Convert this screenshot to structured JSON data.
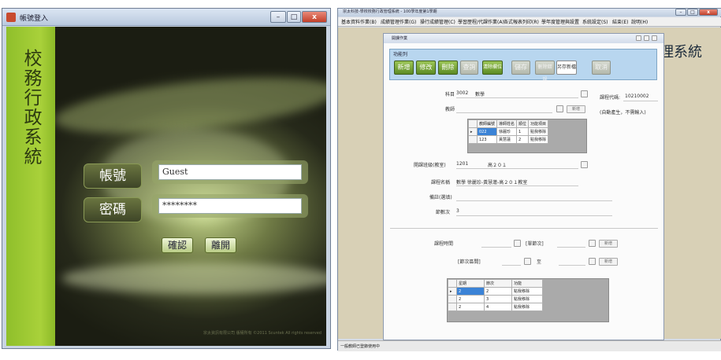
{
  "login": {
    "title": "帳號登入",
    "window_controls": [
      "–",
      "□",
      "x"
    ],
    "vertical_title": "校務行政系統",
    "account_label": "帳號",
    "account_value": "Guest",
    "password_label": "密碼",
    "password_value": "********",
    "confirm_button": "確認",
    "leave_button": "離開",
    "copyright": "宗太資訊有限公司 版權所有 ©2011 Scuntek All rights reserved"
  },
  "main": {
    "title": "宗太科技-學校校務行政管理系統 - 100學年度第1學期",
    "menu": [
      "基本資料作業(B)",
      "成績管理作業(G)",
      "操行成績管理(C)",
      "學習歷程/代課作業(A)",
      "各式報表列印(R)",
      "學年度管理與設置",
      "系統設定(S)",
      "結束(E)",
      "說明(H)"
    ],
    "banner": "理系統",
    "status": "一般教師已登錄使用中",
    "form": {
      "title": "開課作業",
      "group_label": "功能列",
      "buttons": [
        {
          "label": "新增",
          "enabled": true
        },
        {
          "label": "修改",
          "enabled": true
        },
        {
          "label": "刪除",
          "enabled": true
        },
        {
          "label": "查詢",
          "enabled": false
        },
        {
          "label": "清除欄位",
          "enabled": true
        },
        {
          "label": "儲存",
          "enabled": false
        },
        {
          "label": "刪除錯誤",
          "enabled": false
        },
        {
          "label": "另存新檔",
          "enabled": true,
          "style": "white"
        },
        {
          "label": "取消",
          "enabled": false
        }
      ],
      "subject_label": "科目",
      "subject_code": "3002",
      "subject_name": "數學",
      "course_code_label": "課程代碼:",
      "course_code_value": "10210002",
      "course_code_note": "(自動產生，不需輸入)",
      "teacher_label": "教師",
      "teacher_add_button": "新增",
      "teacher_grid": {
        "headers": [
          "教師編號",
          "導師姓名",
          "順位",
          "功能項目"
        ],
        "rows": [
          [
            "022",
            "徐麗珍",
            "1",
            "點我移除"
          ],
          [
            "123",
            "黃慧蓮",
            "2",
            "點我移除"
          ]
        ]
      },
      "class_label": "開課班級(教室)",
      "class_code": "1201",
      "class_name": "高２０１",
      "course_name_label": "課程名稱",
      "course_name_value": "數學 徐麗珍-黃慧蓮-高２０１教室",
      "remark_label": "備註(選填)",
      "periods_label": "節數次",
      "periods_value": "3",
      "schedule_time_label": "課程時間",
      "period_count_label": "[單節次]",
      "schedule_add_button": "新增",
      "period_range_label": "[節次區間]",
      "to_label": "至",
      "range_add_button": "新增",
      "schedule_grid": {
        "headers": [
          "星期",
          "節次",
          "功能"
        ],
        "rows": [
          [
            "2",
            "2",
            "點我移除"
          ],
          [
            "2",
            "3",
            "點我移除"
          ],
          [
            "2",
            "4",
            "點我移除"
          ]
        ]
      }
    }
  }
}
